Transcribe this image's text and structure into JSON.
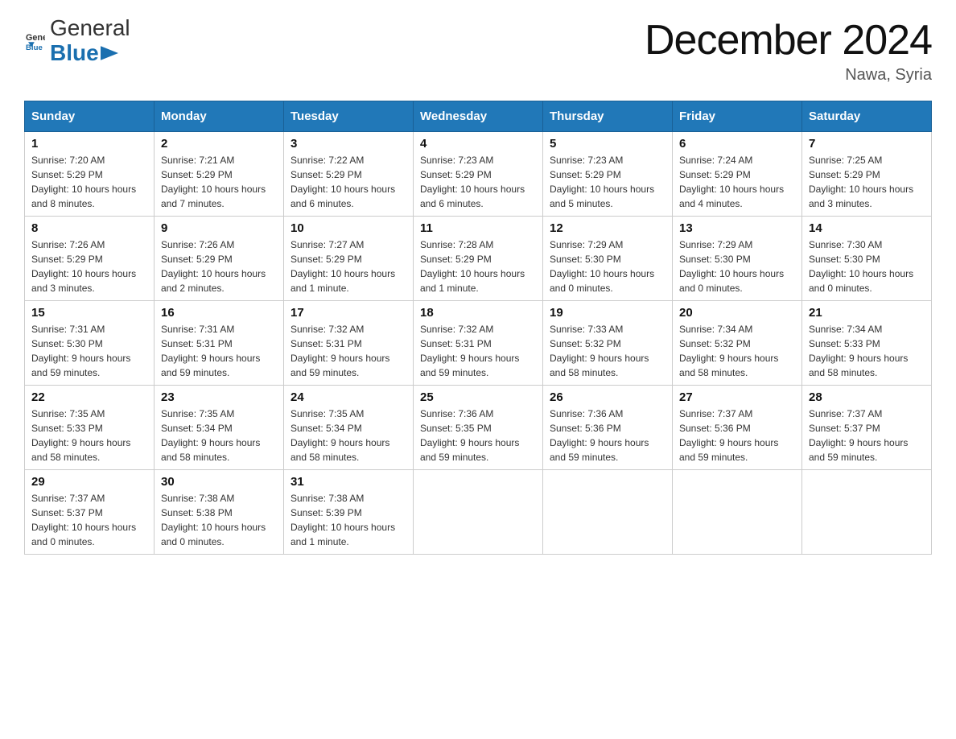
{
  "header": {
    "logo_general": "General",
    "logo_blue": "Blue",
    "month_title": "December 2024",
    "location": "Nawa, Syria"
  },
  "weekdays": [
    "Sunday",
    "Monday",
    "Tuesday",
    "Wednesday",
    "Thursday",
    "Friday",
    "Saturday"
  ],
  "weeks": [
    [
      {
        "day": "1",
        "sunrise": "7:20 AM",
        "sunset": "5:29 PM",
        "daylight": "10 hours and 8 minutes."
      },
      {
        "day": "2",
        "sunrise": "7:21 AM",
        "sunset": "5:29 PM",
        "daylight": "10 hours and 7 minutes."
      },
      {
        "day": "3",
        "sunrise": "7:22 AM",
        "sunset": "5:29 PM",
        "daylight": "10 hours and 6 minutes."
      },
      {
        "day": "4",
        "sunrise": "7:23 AM",
        "sunset": "5:29 PM",
        "daylight": "10 hours and 6 minutes."
      },
      {
        "day": "5",
        "sunrise": "7:23 AM",
        "sunset": "5:29 PM",
        "daylight": "10 hours and 5 minutes."
      },
      {
        "day": "6",
        "sunrise": "7:24 AM",
        "sunset": "5:29 PM",
        "daylight": "10 hours and 4 minutes."
      },
      {
        "day": "7",
        "sunrise": "7:25 AM",
        "sunset": "5:29 PM",
        "daylight": "10 hours and 3 minutes."
      }
    ],
    [
      {
        "day": "8",
        "sunrise": "7:26 AM",
        "sunset": "5:29 PM",
        "daylight": "10 hours and 3 minutes."
      },
      {
        "day": "9",
        "sunrise": "7:26 AM",
        "sunset": "5:29 PM",
        "daylight": "10 hours and 2 minutes."
      },
      {
        "day": "10",
        "sunrise": "7:27 AM",
        "sunset": "5:29 PM",
        "daylight": "10 hours and 1 minute."
      },
      {
        "day": "11",
        "sunrise": "7:28 AM",
        "sunset": "5:29 PM",
        "daylight": "10 hours and 1 minute."
      },
      {
        "day": "12",
        "sunrise": "7:29 AM",
        "sunset": "5:30 PM",
        "daylight": "10 hours and 0 minutes."
      },
      {
        "day": "13",
        "sunrise": "7:29 AM",
        "sunset": "5:30 PM",
        "daylight": "10 hours and 0 minutes."
      },
      {
        "day": "14",
        "sunrise": "7:30 AM",
        "sunset": "5:30 PM",
        "daylight": "10 hours and 0 minutes."
      }
    ],
    [
      {
        "day": "15",
        "sunrise": "7:31 AM",
        "sunset": "5:30 PM",
        "daylight": "9 hours and 59 minutes."
      },
      {
        "day": "16",
        "sunrise": "7:31 AM",
        "sunset": "5:31 PM",
        "daylight": "9 hours and 59 minutes."
      },
      {
        "day": "17",
        "sunrise": "7:32 AM",
        "sunset": "5:31 PM",
        "daylight": "9 hours and 59 minutes."
      },
      {
        "day": "18",
        "sunrise": "7:32 AM",
        "sunset": "5:31 PM",
        "daylight": "9 hours and 59 minutes."
      },
      {
        "day": "19",
        "sunrise": "7:33 AM",
        "sunset": "5:32 PM",
        "daylight": "9 hours and 58 minutes."
      },
      {
        "day": "20",
        "sunrise": "7:34 AM",
        "sunset": "5:32 PM",
        "daylight": "9 hours and 58 minutes."
      },
      {
        "day": "21",
        "sunrise": "7:34 AM",
        "sunset": "5:33 PM",
        "daylight": "9 hours and 58 minutes."
      }
    ],
    [
      {
        "day": "22",
        "sunrise": "7:35 AM",
        "sunset": "5:33 PM",
        "daylight": "9 hours and 58 minutes."
      },
      {
        "day": "23",
        "sunrise": "7:35 AM",
        "sunset": "5:34 PM",
        "daylight": "9 hours and 58 minutes."
      },
      {
        "day": "24",
        "sunrise": "7:35 AM",
        "sunset": "5:34 PM",
        "daylight": "9 hours and 58 minutes."
      },
      {
        "day": "25",
        "sunrise": "7:36 AM",
        "sunset": "5:35 PM",
        "daylight": "9 hours and 59 minutes."
      },
      {
        "day": "26",
        "sunrise": "7:36 AM",
        "sunset": "5:36 PM",
        "daylight": "9 hours and 59 minutes."
      },
      {
        "day": "27",
        "sunrise": "7:37 AM",
        "sunset": "5:36 PM",
        "daylight": "9 hours and 59 minutes."
      },
      {
        "day": "28",
        "sunrise": "7:37 AM",
        "sunset": "5:37 PM",
        "daylight": "9 hours and 59 minutes."
      }
    ],
    [
      {
        "day": "29",
        "sunrise": "7:37 AM",
        "sunset": "5:37 PM",
        "daylight": "10 hours and 0 minutes."
      },
      {
        "day": "30",
        "sunrise": "7:38 AM",
        "sunset": "5:38 PM",
        "daylight": "10 hours and 0 minutes."
      },
      {
        "day": "31",
        "sunrise": "7:38 AM",
        "sunset": "5:39 PM",
        "daylight": "10 hours and 1 minute."
      },
      null,
      null,
      null,
      null
    ]
  ],
  "labels": {
    "sunrise": "Sunrise:",
    "sunset": "Sunset:",
    "daylight": "Daylight:"
  }
}
